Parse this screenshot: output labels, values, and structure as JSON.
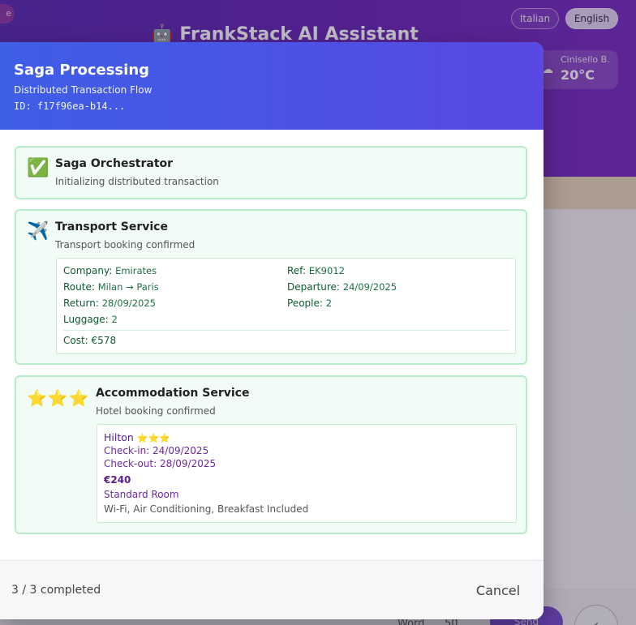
{
  "background": {
    "left_pill": "e",
    "languages": [
      "Italian",
      "English"
    ],
    "app_title": "FrankStack AI Assistant",
    "app_icon": "robot-icon",
    "weather": {
      "city": "Cinisello B.",
      "temperature": "20°C",
      "icon": "cloud-icon"
    },
    "footer_words": "Word",
    "footer_count": "50",
    "send_label": "Send"
  },
  "modal": {
    "title": "Saga Processing",
    "subtitle": "Distributed Transaction Flow",
    "id_text": "ID: f17f96ea-b14...",
    "accent_colors": {
      "header_start": "#3e5ee6",
      "header_end": "#5848e4",
      "success_border": "#b8ecc9",
      "success_bg": "#f0fcf5"
    },
    "steps": [
      {
        "icon": "check-icon",
        "title": "Saga Orchestrator",
        "description": "Initializing distributed transaction"
      },
      {
        "icon": "airplane-icon",
        "title": "Transport Service",
        "description": "Transport booking confirmed",
        "details": {
          "company_label": "Company:",
          "company": "Emirates",
          "ref_label": "Ref:",
          "ref": "EK9012",
          "route_label": "Route:",
          "route": "Milan → Paris",
          "departure_label": "Departure:",
          "departure": "24/09/2025",
          "return_label": "Return:",
          "return": "28/09/2025",
          "people_label": "People:",
          "people": "2",
          "luggage_label": "Luggage:",
          "luggage": "2",
          "cost": "Cost: €578"
        }
      },
      {
        "icon": "three-stars-icon",
        "title": "Accommodation Service",
        "description": "Hotel booking confirmed",
        "details": {
          "hotel": "Hilton",
          "rating": 3,
          "checkin": "Check-in: 24/09/2025",
          "checkout": "Check-out: 28/09/2025",
          "price": "€240",
          "room": "Standard Room",
          "amenities": "Wi-Fi, Air Conditioning, Breakfast Included"
        }
      }
    ],
    "progress": "3 / 3 completed",
    "cancel_label": "Cancel"
  }
}
